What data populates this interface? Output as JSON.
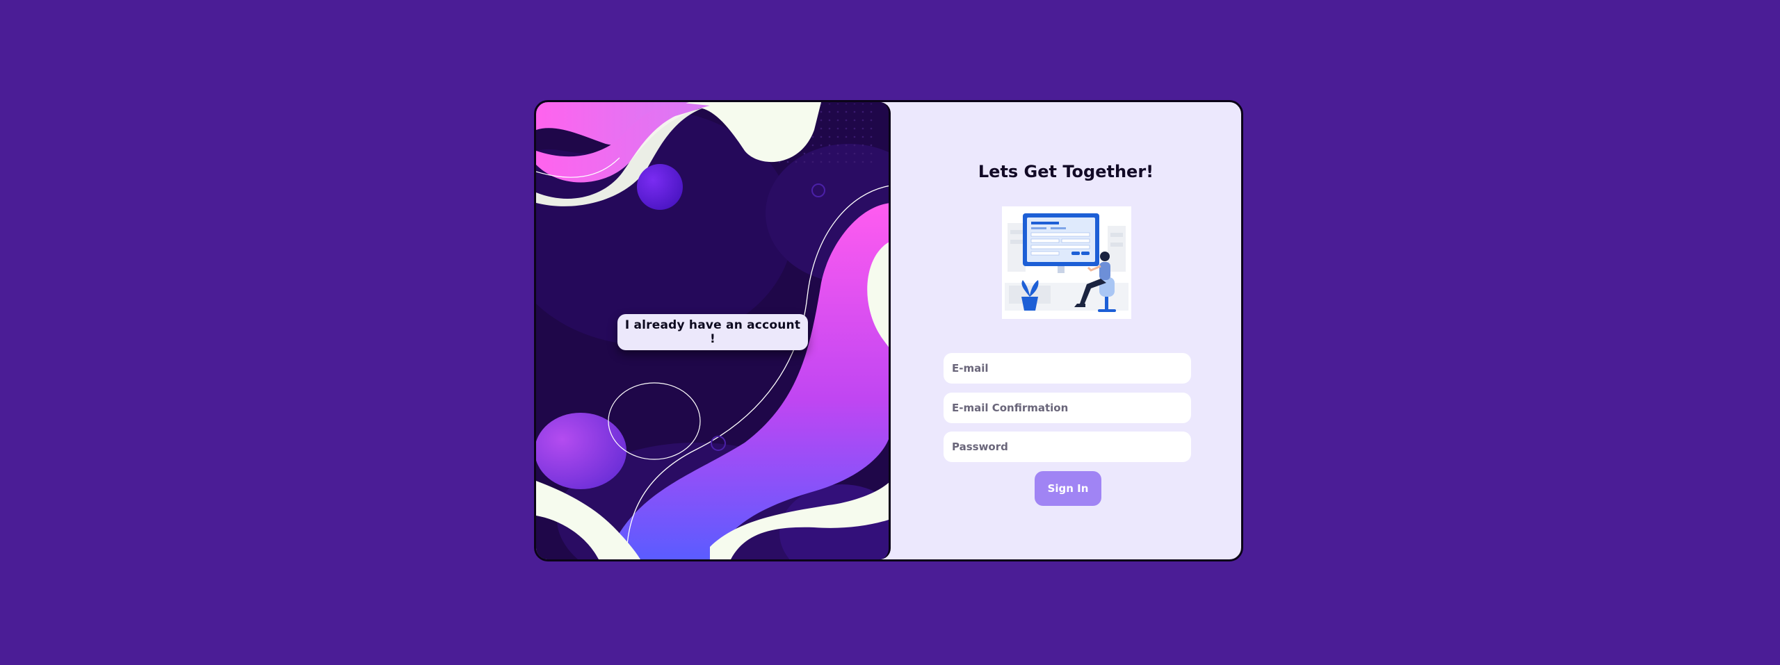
{
  "left_panel": {
    "switch_label": "I already have an account !"
  },
  "right_panel": {
    "title": "Lets Get Together!",
    "fields": {
      "email_placeholder": "E-mail",
      "email_confirm_placeholder": "E-mail Confirmation",
      "password_placeholder": "Password"
    },
    "submit_label": "Sign In"
  },
  "colors": {
    "page_background": "#4b1d96",
    "card_background": "#ece8fd",
    "accent": "#a084f4",
    "left_panel_background": "#1f0749"
  },
  "illustration": {
    "icon": "person-filling-form-illustration"
  }
}
